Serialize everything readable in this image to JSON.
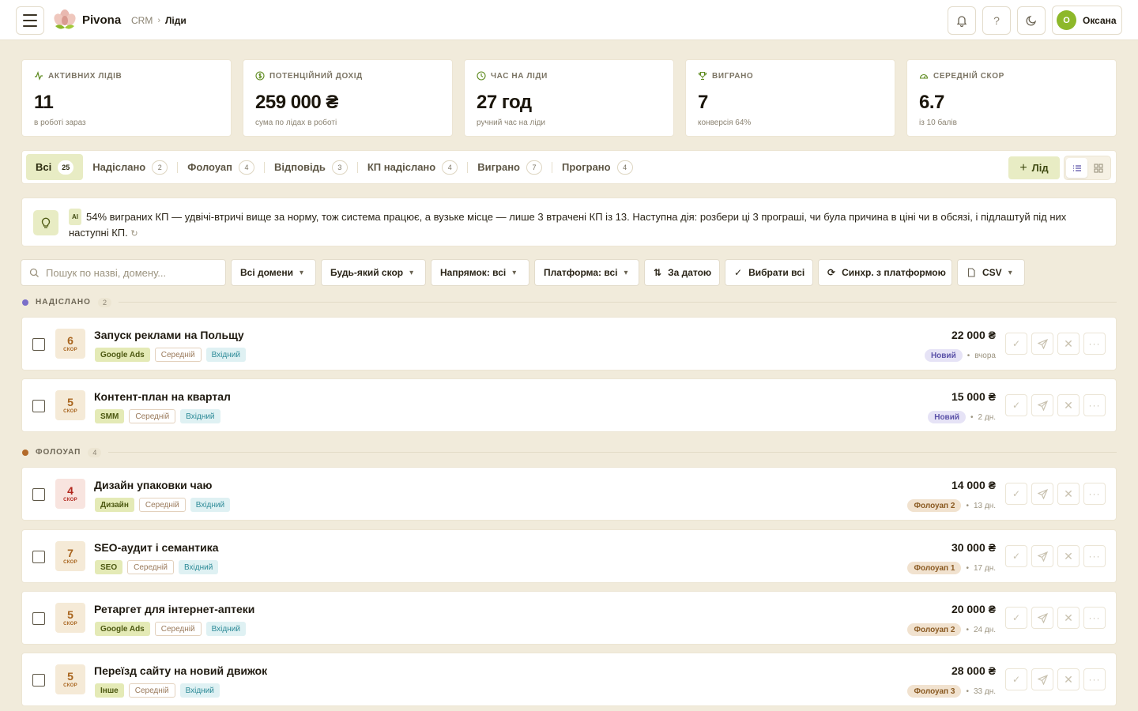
{
  "header": {
    "brand": "Pivona",
    "breadcrumb": [
      "CRM",
      "Ліди"
    ],
    "user": {
      "initial": "О",
      "name": "Оксана"
    }
  },
  "stats": [
    {
      "label": "АКТИВНИХ ЛІДІВ",
      "value": "11",
      "sub": "в роботі зараз",
      "icon": "activity-icon"
    },
    {
      "label": "ПОТЕНЦІЙНИЙ ДОХІД",
      "value": "259 000 ₴",
      "sub": "сума по лідах в роботі",
      "icon": "dollar-circle-icon"
    },
    {
      "label": "ЧАС НА ЛІДИ",
      "value": "27 год",
      "sub": "ручний час на ліди",
      "icon": "clock-icon"
    },
    {
      "label": "ВИГРАНО",
      "value": "7",
      "sub": "конверсія 64%",
      "icon": "trophy-icon"
    },
    {
      "label": "СЕРЕДНІЙ СКОР",
      "value": "6.7",
      "sub": "із 10 балів",
      "icon": "gauge-icon"
    }
  ],
  "tabs": [
    {
      "label": "Всі",
      "count": "25",
      "active": true
    },
    {
      "label": "Надіслано",
      "count": "2"
    },
    {
      "label": "Фолоуап",
      "count": "4"
    },
    {
      "label": "Відповідь",
      "count": "3"
    },
    {
      "label": "КП надіслано",
      "count": "4"
    },
    {
      "label": "Виграно",
      "count": "7"
    },
    {
      "label": "Програно",
      "count": "4"
    }
  ],
  "add_lead_label": "Лід",
  "insight": {
    "badge": "AI",
    "text": "54% виграних КП — удвічі-втричі вище за норму, тож система працює, а вузьке місце — лише 3 втрачені КП із 13. Наступна дія: розбери ці 3 програші, чи була причина в ціні чи в обсязі, і підлаштуй під них наступні КП.",
    "refresh": "↻"
  },
  "filters": {
    "search_placeholder": "Пошук по назві, домену...",
    "domains": "Всі домени",
    "score": "Будь-який скор",
    "direction": "Напрямок: всі",
    "platform": "Платформа: всі",
    "sort": "За датою",
    "select_all": "Вибрати всі",
    "sync": "Синхр. з платформою",
    "csv": "CSV"
  },
  "score_label": "СКОР",
  "groups": [
    {
      "name": "НАДІСЛАНО",
      "count": "2",
      "color": "#7b6fc9",
      "leads": [
        {
          "score": "6",
          "level": "mid",
          "title": "Запуск реклами на Польщу",
          "domain": "Google Ads",
          "size": "Середній",
          "direction": "Вхідний",
          "amount": "22 000 ₴",
          "status": "Новий",
          "status_kind": "new",
          "age": "вчора"
        },
        {
          "score": "5",
          "level": "mid",
          "title": "Контент-план на квартал",
          "domain": "SMM",
          "size": "Середній",
          "direction": "Вхідний",
          "amount": "15 000 ₴",
          "status": "Новий",
          "status_kind": "new",
          "age": "2 дн."
        }
      ]
    },
    {
      "name": "ФОЛОУАП",
      "count": "4",
      "color": "#b36a2a",
      "leads": [
        {
          "score": "4",
          "level": "low",
          "title": "Дизайн упаковки чаю",
          "domain": "Дизайн",
          "size": "Середній",
          "direction": "Вхідний",
          "amount": "14 000 ₴",
          "status": "Фолоуап 2",
          "status_kind": "fu",
          "age": "13 дн."
        },
        {
          "score": "7",
          "level": "mid",
          "title": "SEO-аудит і семантика",
          "domain": "SEO",
          "size": "Середній",
          "direction": "Вхідний",
          "amount": "30 000 ₴",
          "status": "Фолоуап 1",
          "status_kind": "fu",
          "age": "17 дн."
        },
        {
          "score": "5",
          "level": "mid",
          "title": "Ретаргет для інтернет-аптеки",
          "domain": "Google Ads",
          "size": "Середній",
          "direction": "Вхідний",
          "amount": "20 000 ₴",
          "status": "Фолоуап 2",
          "status_kind": "fu",
          "age": "24 дн."
        },
        {
          "score": "5",
          "level": "mid",
          "title": "Переїзд сайту на новий движок",
          "domain": "Інше",
          "size": "Середній",
          "direction": "Вхідний",
          "amount": "28 000 ₴",
          "status": "Фолоуап 3",
          "status_kind": "fu",
          "age": "33 дн."
        }
      ]
    }
  ]
}
